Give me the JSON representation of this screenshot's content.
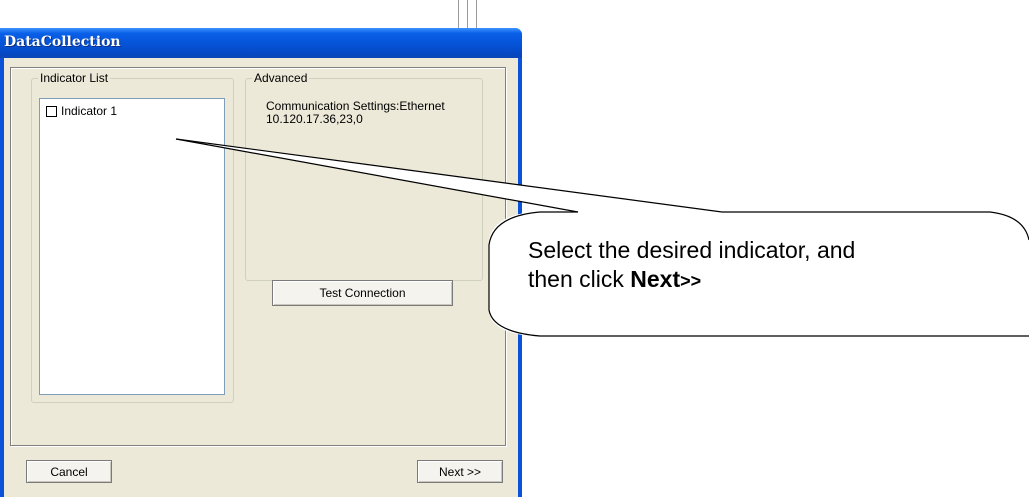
{
  "window": {
    "title": "DataCollection"
  },
  "indicator_list": {
    "label": "Indicator List",
    "items": [
      {
        "label": "Indicator 1",
        "checked": false
      }
    ]
  },
  "advanced": {
    "label": "Advanced",
    "communication_settings": "Communication Settings:Ethernet",
    "address": "10.120.17.36,23,0",
    "test_button": "Test Connection"
  },
  "footer": {
    "cancel_label": "Cancel",
    "next_label": "Next >>"
  },
  "callout": {
    "text_before": "Select the desired indicator, and",
    "text_line2_before": "then click ",
    "text_bold": "Next",
    "text_bold_small": ">>"
  },
  "colors": {
    "titlebar": "#0553d6",
    "dialog_face": "#ece9d8",
    "list_border": "#7f9db9"
  }
}
